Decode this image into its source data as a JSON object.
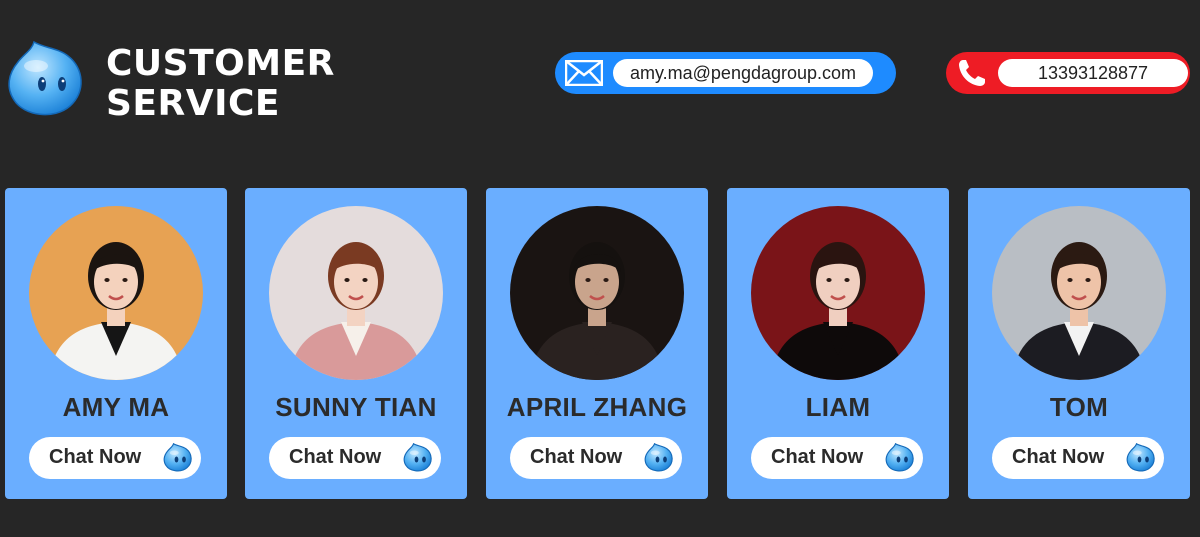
{
  "header": {
    "title_line1": "CUSTOMER",
    "title_line2": "SERVICE",
    "logo_icon": "droplet-mascot-icon"
  },
  "contact": {
    "email": "amy.ma@pengdagroup.com",
    "email_icon": "envelope-icon",
    "phone": "13393128877",
    "phone_icon": "phone-icon"
  },
  "agents": [
    {
      "name": "AMY MA",
      "button": "Chat Now",
      "avatar_bg": "#e7a253"
    },
    {
      "name": "SUNNY TIAN",
      "button": "Chat Now",
      "avatar_bg": "#e4dcdc"
    },
    {
      "name": "APRIL ZHANG",
      "button": "Chat Now",
      "avatar_bg": "#1a1412"
    },
    {
      "name": "LIAM",
      "button": "Chat Now",
      "avatar_bg": "#7a1418"
    },
    {
      "name": "TOM",
      "button": "Chat Now",
      "avatar_bg": "#b9bec4"
    }
  ],
  "colors": {
    "background": "#262626",
    "card": "#6aaeff",
    "email_pill": "#1e8bff",
    "phone_pill": "#ee1c25"
  }
}
